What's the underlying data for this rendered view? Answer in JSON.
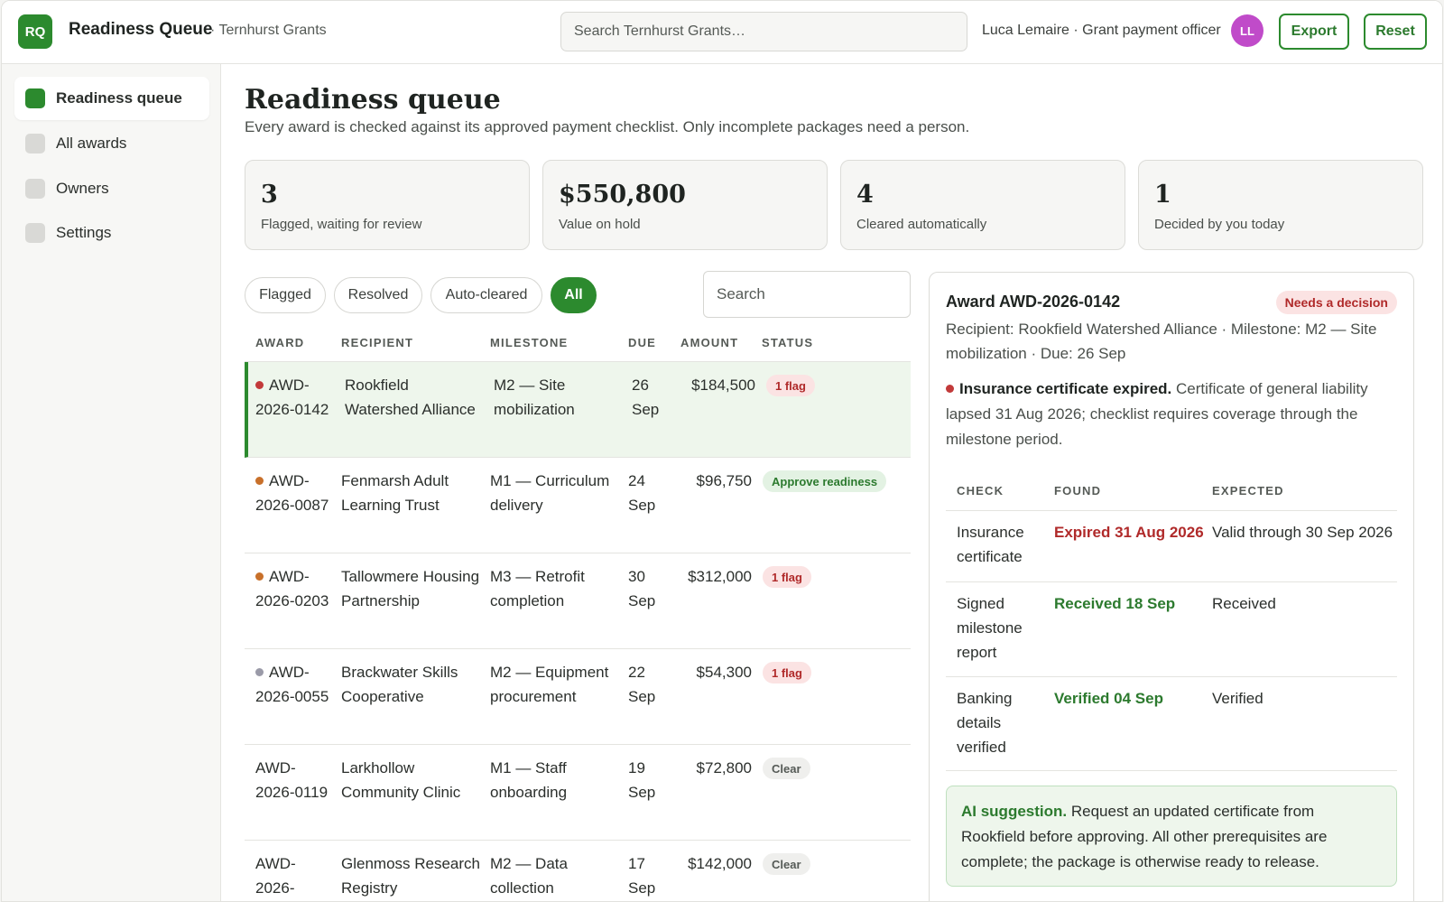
{
  "header": {
    "logo": "RQ",
    "title": "Readiness Queue",
    "org": "· Ternhurst Grants",
    "search_placeholder": "Search Ternhurst Grants…",
    "user": "Luca Lemaire · Grant payment officer",
    "avatar": "LL",
    "export_label": "Export",
    "reset_label": "Reset"
  },
  "sidebar": {
    "items": [
      {
        "label": "Readiness queue",
        "icon": "square-icon"
      },
      {
        "label": "All awards",
        "icon": "square-icon"
      },
      {
        "label": "Owners",
        "icon": "square-icon"
      },
      {
        "label": "Settings",
        "icon": "square-icon"
      }
    ]
  },
  "main": {
    "title": "Readiness queue",
    "subtitle": "Every award is checked against its approved payment checklist. Only incomplete packages need a person.",
    "stats": [
      {
        "value": "3",
        "label": "Flagged, waiting for review"
      },
      {
        "value": "$550,800",
        "label": "Value on hold"
      },
      {
        "value": "4",
        "label": "Cleared automatically"
      },
      {
        "value": "1",
        "label": "Decided by you today"
      }
    ],
    "filters": [
      "Flagged",
      "Resolved",
      "Auto-cleared",
      "All"
    ],
    "table_search_placeholder": "Search",
    "columns": [
      "AWARD",
      "RECIPIENT",
      "MILESTONE",
      "DUE",
      "AMOUNT",
      "STATUS"
    ],
    "rows": [
      {
        "award": "AWD-2026-0142",
        "recipient": "Rookfield Watershed Alliance",
        "milestone": "M2 — Site mobilization",
        "due": "26 Sep",
        "amount": "$184,500",
        "status": "1 flag"
      },
      {
        "award": "AWD-2026-0087",
        "recipient": "Fenmarsh Adult Learning Trust",
        "milestone": "M1 — Curriculum delivery",
        "due": "24 Sep",
        "amount": "$96,750",
        "status": "Approve readiness"
      },
      {
        "award": "AWD-2026-0203",
        "recipient": "Tallowmere Housing Partnership",
        "milestone": "M3 — Retrofit completion",
        "due": "30 Sep",
        "amount": "$312,000",
        "status": "1 flag"
      },
      {
        "award": "AWD-2026-0055",
        "recipient": "Brackwater Skills Cooperative",
        "milestone": "M2 — Equipment procurement",
        "due": "22 Sep",
        "amount": "$54,300",
        "status": "1 flag"
      },
      {
        "award": "AWD-2026-0119",
        "recipient": "Larkhollow Community Clinic",
        "milestone": "M1 — Staff onboarding",
        "due": "19 Sep",
        "amount": "$72,800",
        "status": "Clear"
      },
      {
        "award": "AWD-2026-",
        "recipient": "Glenmoss Research Registry",
        "milestone": "M2 — Data collection",
        "due": "17 Sep",
        "amount": "$142,000",
        "status": "Clear"
      }
    ]
  },
  "detail": {
    "title": "Award AWD-2026-0142",
    "badge": "Needs a decision",
    "meta": "Recipient: Rookfield Watershed Alliance · Milestone: M2 — Site mobilization · Due: 26 Sep",
    "issue_title": "Insurance certificate expired.",
    "issue_text": "Certificate of general liability lapsed 31 Aug 2026; checklist requires coverage through the milestone period.",
    "check_columns": [
      "CHECK",
      "FOUND",
      "EXPECTED"
    ],
    "checks": [
      {
        "check": "Insurance certificate",
        "found": "Expired 31 Aug 2026",
        "expected": "Valid through 30 Sep 2026"
      },
      {
        "check": "Signed milestone report",
        "found": "Received 18 Sep",
        "expected": "Received"
      },
      {
        "check": "Banking details verified",
        "found": "Verified 04 Sep",
        "expected": "Verified"
      }
    ],
    "ai_label": "AI suggestion.",
    "ai_text": "Request an updated certificate from Rookfield before approving. All other prerequisites are complete; the package is otherwise ready to release."
  },
  "colors": {
    "accent": "#2c8a2e",
    "flag": "#b02a2a",
    "dot_red": "#c23a3a",
    "dot_orange": "#c8702a",
    "dot_gray": "#9a9aa8"
  }
}
